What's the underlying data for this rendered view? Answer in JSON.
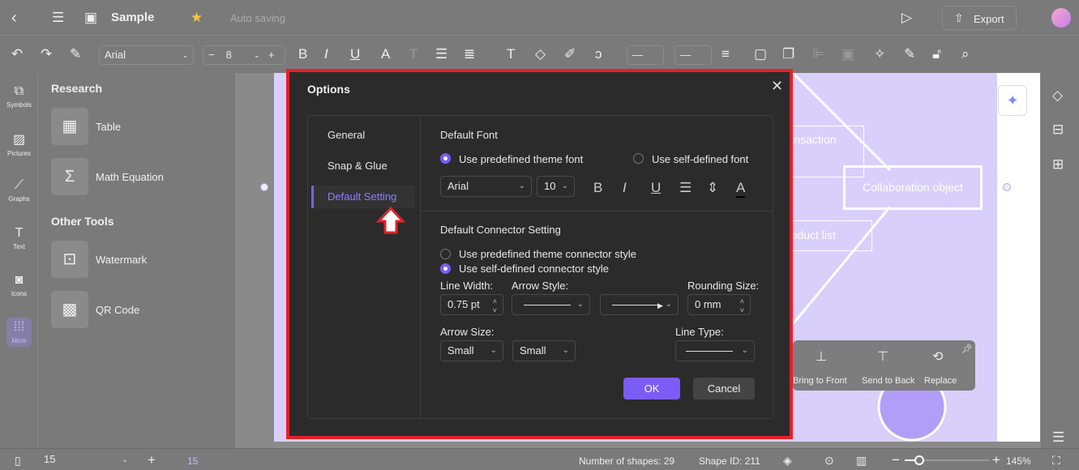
{
  "header": {
    "title": "Sample",
    "status": "Auto saving",
    "export_label": "Export"
  },
  "toolbar": {
    "font": "Arial",
    "font_size": "8"
  },
  "rail": {
    "items": [
      {
        "label": "Symbols",
        "icon": "symbols-icon"
      },
      {
        "label": "Pictures",
        "icon": "pictures-icon"
      },
      {
        "label": "Graphs",
        "icon": "graphs-icon"
      },
      {
        "label": "Text",
        "icon": "text-icon"
      },
      {
        "label": "Icons",
        "icon": "icons-icon"
      },
      {
        "label": "More",
        "icon": "more-icon"
      }
    ]
  },
  "panel": {
    "section1": "Research",
    "section1_items": [
      "Table",
      "Math Equation"
    ],
    "section2": "Other Tools",
    "section2_items": [
      "Watermark",
      "QR Code"
    ]
  },
  "canvas": {
    "shapes": [
      "ransaction",
      "Collaboration object",
      "roduct list"
    ],
    "context_menu": [
      "Bring to Front",
      "Send to Back",
      "Replace"
    ]
  },
  "dialog": {
    "title": "Options",
    "nav": [
      "General",
      "Snap & Glue",
      "Default Setting"
    ],
    "active_nav": "Default Setting",
    "font_section": "Default Font",
    "font_option1": "Use predefined theme font",
    "font_option2": "Use self-defined font",
    "font": "Arial",
    "font_size": "10",
    "connector_section": "Default Connector Setting",
    "conn_option1": "Use predefined theme connector style",
    "conn_option2": "Use self-defined connector style",
    "line_width_label": "Line Width:",
    "line_width": "0.75 pt",
    "arrow_style_label": "Arrow Style:",
    "rounding_label": "Rounding Size:",
    "rounding": "0 mm",
    "arrow_size_label": "Arrow Size:",
    "arrow_size1": "Small",
    "arrow_size2": "Small",
    "line_type_label": "Line Type:",
    "ok": "OK",
    "cancel": "Cancel"
  },
  "statusbar": {
    "page": "15",
    "page_tab": "15",
    "shapes": "Number of shapes: 29",
    "shape_id": "Shape ID: 211",
    "zoom": "145%"
  },
  "colors": {
    "accent": "#7b5cf5",
    "highlight": "#e5202a",
    "canvas_purple": "#d8d0fb"
  }
}
